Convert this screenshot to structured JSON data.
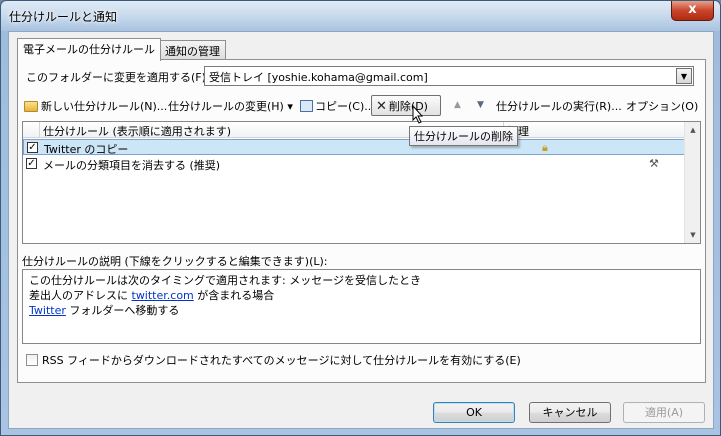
{
  "window": {
    "title": "仕分けルールと通知",
    "close_glyph": "x"
  },
  "tabs": [
    {
      "label": "電子メールの仕分けルール"
    },
    {
      "label": "通知の管理"
    }
  ],
  "folder_row": {
    "label": "このフォルダーに変更を適用する(F):",
    "value": "受信トレイ [yoshie.kohama@gmail.com]"
  },
  "toolbar": {
    "new_rule": "新しい仕分けルール(N)...",
    "change_rule": "仕分けルールの変更(H) ▾",
    "copy": "コピー(C)...",
    "delete": "削除(D)",
    "run_rules": "仕分けルールの実行(R)...",
    "options": "オプション(O)"
  },
  "rules_list": {
    "headers": {
      "rule": "仕分けルール (表示順に適用されます)",
      "action": "処理"
    },
    "rows": [
      {
        "checked": "✓",
        "label": "Twitter のコピー",
        "selected": true,
        "icon": "lock-icon"
      },
      {
        "checked": "✓",
        "label": "メールの分類項目を消去する (推奨)",
        "selected": false,
        "icon": "tools-icon"
      }
    ]
  },
  "tooltip": {
    "text": "仕分けルールの削除"
  },
  "description": {
    "label": "仕分けルールの説明 (下線をクリックすると編集できます)(L):",
    "line1": "この仕分けルールは次のタイミングで適用されます: メッセージを受信したとき",
    "line2_prefix": "差出人のアドレスに",
    "line2_link": "twitter.com",
    "line2_suffix": "が含まれる場合",
    "line3_link": "Twitter",
    "line3_suffix": "フォルダーへ移動する"
  },
  "rss": {
    "label": "RSS フィードからダウンロードされたすべてのメッセージに対して仕分けルールを有効にする(E)"
  },
  "buttons": {
    "ok": "OK",
    "cancel": "キャンセル",
    "apply": "適用(A)"
  }
}
